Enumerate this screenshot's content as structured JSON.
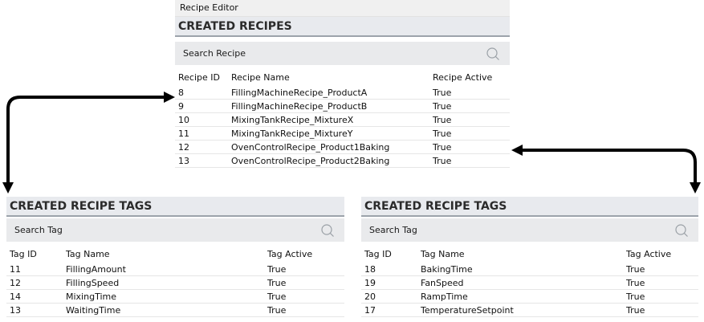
{
  "recipe_editor": {
    "window_title": "Recipe Editor",
    "header": "CREATED RECIPES",
    "search_placeholder": "Search Recipe",
    "columns": [
      "Recipe ID",
      "Recipe Name",
      "Recipe Active"
    ],
    "rows": [
      [
        "8",
        "FillingMachineRecipe_ProductA",
        "True"
      ],
      [
        "9",
        "FillingMachineRecipe_ProductB",
        "True"
      ],
      [
        "10",
        "MixingTankRecipe_MixtureX",
        "True"
      ],
      [
        "11",
        "MixingTankRecipe_MixtureY",
        "True"
      ],
      [
        "12",
        "OvenControlRecipe_Product1Baking",
        "True"
      ],
      [
        "13",
        "OvenControlRecipe_Product2Baking",
        "True"
      ]
    ]
  },
  "left_tags": {
    "header": "CREATED RECIPE TAGS",
    "search_placeholder": "Search Tag",
    "columns": [
      "Tag ID",
      "Tag Name",
      "Tag Active"
    ],
    "rows": [
      [
        "11",
        "FillingAmount",
        "True"
      ],
      [
        "12",
        "FillingSpeed",
        "True"
      ],
      [
        "14",
        "MixingTime",
        "True"
      ],
      [
        "13",
        "WaitingTime",
        "True"
      ]
    ]
  },
  "right_tags": {
    "header": "CREATED RECIPE TAGS",
    "search_placeholder": "Search Tag",
    "columns": [
      "Tag ID",
      "Tag Name",
      "Tag Active"
    ],
    "rows": [
      [
        "18",
        "BakingTime",
        "True"
      ],
      [
        "19",
        "FanSpeed",
        "True"
      ],
      [
        "20",
        "RampTime",
        "True"
      ],
      [
        "17",
        "TemperatureSetpoint",
        "True"
      ]
    ]
  },
  "icons": {
    "search": "search-icon",
    "connector": "arrow-icon"
  },
  "colors": {
    "header_bg": "#e8eaee",
    "header_border": "#9ca3ab",
    "search_bg": "#e9eaec",
    "arrow": "#000000"
  }
}
